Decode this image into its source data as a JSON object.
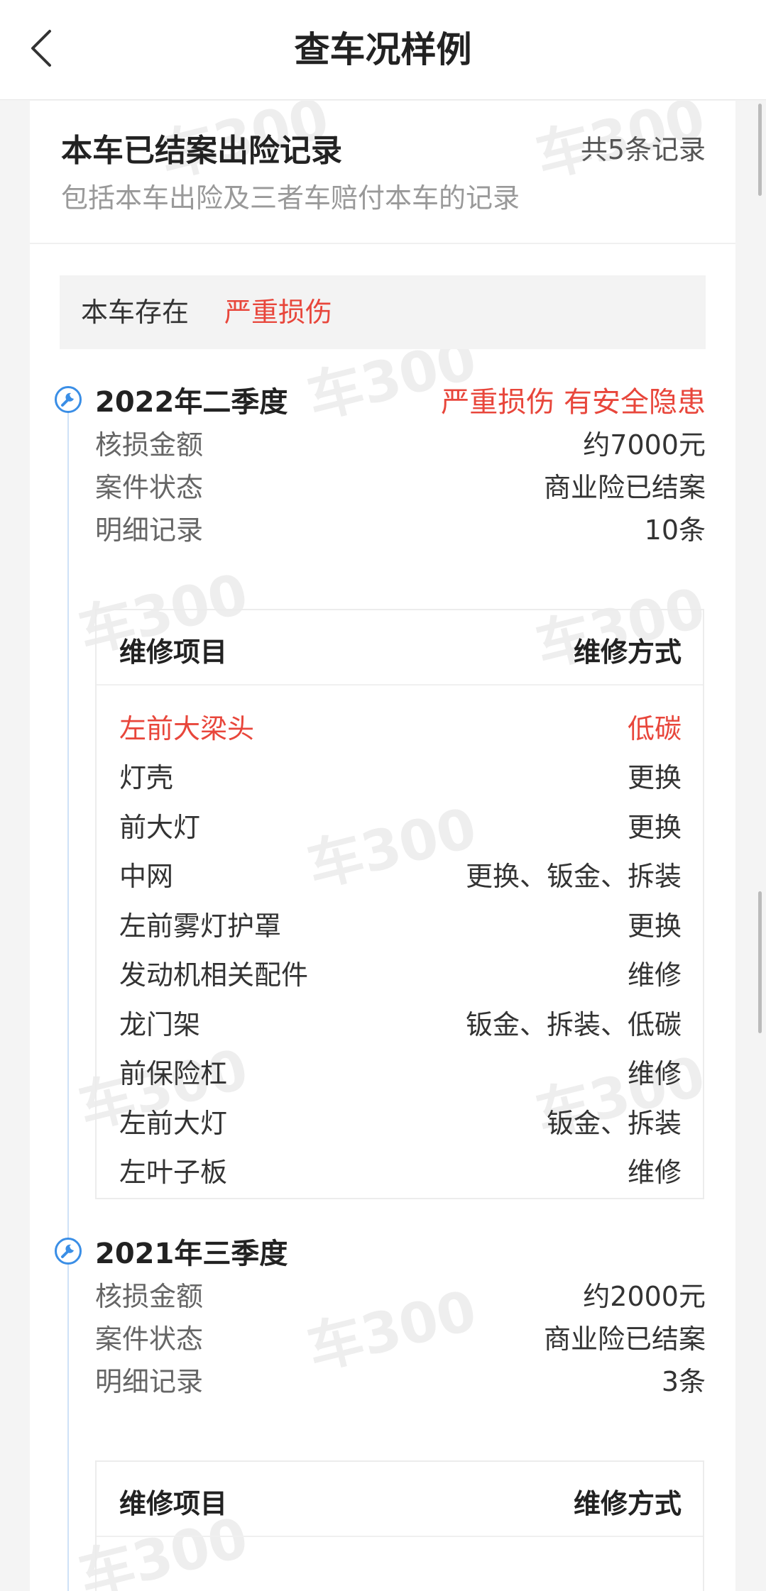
{
  "nav": {
    "title": "查车况样例"
  },
  "header": {
    "title": "本车已结案出险记录",
    "count": "共5条记录",
    "subtitle": "包括本车出险及三者车赔付本车的记录"
  },
  "banner": {
    "prefix": "本车存在",
    "highlight": "严重损伤"
  },
  "watermark": "车300",
  "records": [
    {
      "period": "2022年二季度",
      "warning": "严重损伤 有安全隐患",
      "amount_label": "核损金额",
      "amount": "约7000元",
      "status_label": "案件状态",
      "status": "商业险已结案",
      "detail_label": "明细记录",
      "detail_count": "10条",
      "table_header": {
        "item": "维修项目",
        "method": "维修方式"
      },
      "items": [
        {
          "name": "左前大梁头",
          "method": "低碳",
          "highlight": true
        },
        {
          "name": "灯壳",
          "method": "更换"
        },
        {
          "name": "前大灯",
          "method": "更换"
        },
        {
          "name": "中网",
          "method": "更换、钣金、拆装"
        },
        {
          "name": "左前雾灯护罩",
          "method": "更换"
        },
        {
          "name": "发动机相关配件",
          "method": "维修"
        },
        {
          "name": "龙门架",
          "method": "钣金、拆装、低碳"
        },
        {
          "name": "前保险杠",
          "method": "维修"
        },
        {
          "name": "左前大灯",
          "method": "钣金、拆装"
        },
        {
          "name": "左叶子板",
          "method": "维修"
        }
      ]
    },
    {
      "period": "2021年三季度",
      "amount_label": "核损金额",
      "amount": "约2000元",
      "status_label": "案件状态",
      "status": "商业险已结案",
      "detail_label": "明细记录",
      "detail_count": "3条",
      "table_header": {
        "item": "维修项目",
        "method": "维修方式"
      }
    }
  ]
}
